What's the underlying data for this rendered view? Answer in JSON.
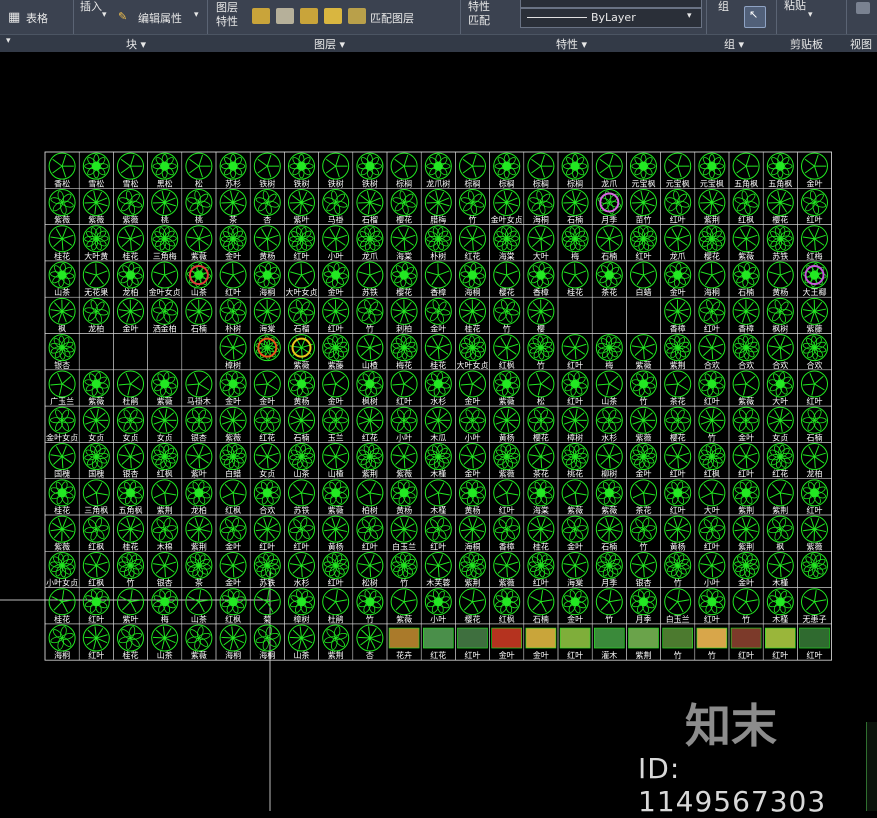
{
  "ribbon": {
    "table_label": "表格",
    "insert_label": "插入",
    "edit_attr_label": "编辑属性",
    "layer_label_line1": "图层",
    "layer_label_line2": "特性",
    "match_layer_label": "匹配图层",
    "props_match_line1": "特性",
    "props_match_line2": "匹配",
    "bylayer_label": "ByLayer",
    "group_label": "组",
    "paste_label": "粘贴",
    "panels": [
      "块 ▾",
      "图层 ▾",
      "特性 ▾",
      "组 ▾",
      "剪贴板",
      "视图"
    ]
  },
  "grid": {
    "row_labels": [
      [
        "香松",
        "雪松",
        "雪松",
        "黑松",
        "松",
        "苏杉",
        "铁树",
        "铁树",
        "铁树",
        "铁树",
        "棕榈",
        "龙爪树",
        "棕榈",
        "棕榈",
        "棕榈",
        "棕榈",
        "龙爪",
        "元宝枫",
        "元宝枫",
        "元宝枫",
        "五角枫",
        "五角枫",
        "金叶"
      ],
      [
        "紫薇",
        "紫薇",
        "紫薇",
        "桃",
        "桃",
        "茶",
        "杏",
        "紫叶",
        "马褂",
        "石榴",
        "樱花",
        "腊梅",
        "竹",
        "金叶女贞",
        "海桐",
        "石楠",
        "月季",
        "苗竹",
        "红叶",
        "紫荆",
        "红枫",
        "樱花",
        "红叶"
      ],
      [
        "桂花",
        "大叶黄",
        "桂花",
        "三角梅",
        "紫薇",
        "金叶",
        "黄杨",
        "红叶",
        "小叶",
        "龙爪",
        "海棠",
        "朴树",
        "红花",
        "海棠",
        "大叶",
        "梅",
        "石楠",
        "红叶",
        "龙爪",
        "樱花",
        "紫薇",
        "苏铁",
        "红梅"
      ],
      [
        "山茶",
        "无花果",
        "龙柏",
        "金叶女贞",
        "山茶",
        "红叶",
        "海桐",
        "大叶女贞",
        "金叶",
        "苏铁",
        "樱花",
        "香樟",
        "海桐",
        "樱花",
        "香樟",
        "桂花",
        "茶花",
        "白蜡",
        "金叶",
        "海桐",
        "石楠",
        "黄杨",
        "大王椰"
      ],
      [
        "枫",
        "龙柏",
        "金叶",
        "洒金柏",
        "石楠",
        "朴树",
        "海棠",
        "石榴",
        "红叶",
        "竹",
        "刺柏",
        "金叶",
        "桂花",
        "竹",
        "樱",
        "",
        "",
        "",
        "香樟",
        "红叶",
        "香樟",
        "枫树",
        "紫藤"
      ],
      [
        "银杏",
        "",
        "",
        "",
        "",
        "樟树",
        "",
        "紫薇",
        "紫藤",
        "山楂",
        "梅花",
        "桂花",
        "大叶女贞",
        "红枫",
        "竹",
        "红叶",
        "梅",
        "紫薇",
        "紫荆",
        "合欢",
        "合欢",
        "合欢",
        "合欢"
      ],
      [
        "广玉兰",
        "紫薇",
        "杜鹃",
        "紫薇",
        "马褂木",
        "金叶",
        "金叶",
        "黄杨",
        "金叶",
        "枫树",
        "红叶",
        "水杉",
        "金叶",
        "紫薇",
        "松",
        "红叶",
        "山茶",
        "竹",
        "茶花",
        "红叶",
        "紫薇",
        "大叶",
        "红叶"
      ],
      [
        "金叶女贞",
        "女贞",
        "女贞",
        "女贞",
        "银杏",
        "紫薇",
        "红花",
        "石楠",
        "玉兰",
        "红花",
        "小叶",
        "木瓜",
        "小叶",
        "黄杨",
        "樱花",
        "樟树",
        "水杉",
        "紫薇",
        "樱花",
        "竹",
        "金叶",
        "女贞",
        "石楠"
      ],
      [
        "国槐",
        "国槐",
        "银杏",
        "红枫",
        "紫叶",
        "白蜡",
        "女贞",
        "山茶",
        "山楂",
        "紫荆",
        "紫薇",
        "木槿",
        "金叶",
        "紫薇",
        "茶花",
        "桃花",
        "柳树",
        "金叶",
        "红叶",
        "红枫",
        "红叶",
        "红花",
        "龙柏"
      ],
      [
        "桂花",
        "三角枫",
        "五角枫",
        "紫荆",
        "龙柏",
        "红枫",
        "合欢",
        "苏铁",
        "紫薇",
        "柏树",
        "黄杨",
        "木槿",
        "黄杨",
        "红叶",
        "海棠",
        "紫薇",
        "紫薇",
        "茶花",
        "红叶",
        "大叶",
        "紫荆",
        "紫荆",
        "红叶"
      ],
      [
        "紫薇",
        "红枫",
        "桂花",
        "木棉",
        "紫荆",
        "金叶",
        "红叶",
        "红叶",
        "黄杨",
        "红叶",
        "白玉兰",
        "红叶",
        "海桐",
        "香樟",
        "桂花",
        "金叶",
        "石楠",
        "竹",
        "黄杨",
        "红叶",
        "紫荆",
        "枫",
        "紫薇"
      ],
      [
        "小叶女贞",
        "红枫",
        "竹",
        "银杏",
        "茶",
        "金叶",
        "苏铁",
        "水杉",
        "红叶",
        "松树",
        "竹",
        "木芙蓉",
        "紫荆",
        "紫薇",
        "红叶",
        "海棠",
        "月季",
        "银杏",
        "竹",
        "小叶",
        "金叶",
        "木槿",
        ""
      ],
      [
        "桂花",
        "红叶",
        "紫叶",
        "梅",
        "山茶",
        "红枫",
        "菊",
        "樟树",
        "杜鹃",
        "竹",
        "紫薇",
        "小叶",
        "樱花",
        "红枫",
        "石楠",
        "金叶",
        "竹",
        "月季",
        "白玉兰",
        "红叶",
        "竹",
        "木槿",
        "无患子"
      ],
      [
        "海桐",
        "红叶",
        "桂花",
        "山茶",
        "紫薇",
        "海桐",
        "海桐",
        "山茶",
        "紫荆",
        "杏",
        "花卉",
        "红花",
        "红叶",
        "金叶",
        "金叶",
        "红叶",
        "灌木",
        "紫荆",
        "竹",
        "竹",
        "红叶",
        "红叶",
        "红叶"
      ]
    ]
  },
  "watermark": {
    "logo_text": "知末",
    "id_text": "ID: 1149567303"
  },
  "colors": {
    "ribbon_bg": "#3b4250",
    "canvas_bg": "#000000",
    "symbol": "#22e822",
    "label": "#ffffff",
    "grid": "#d8d8d8"
  }
}
